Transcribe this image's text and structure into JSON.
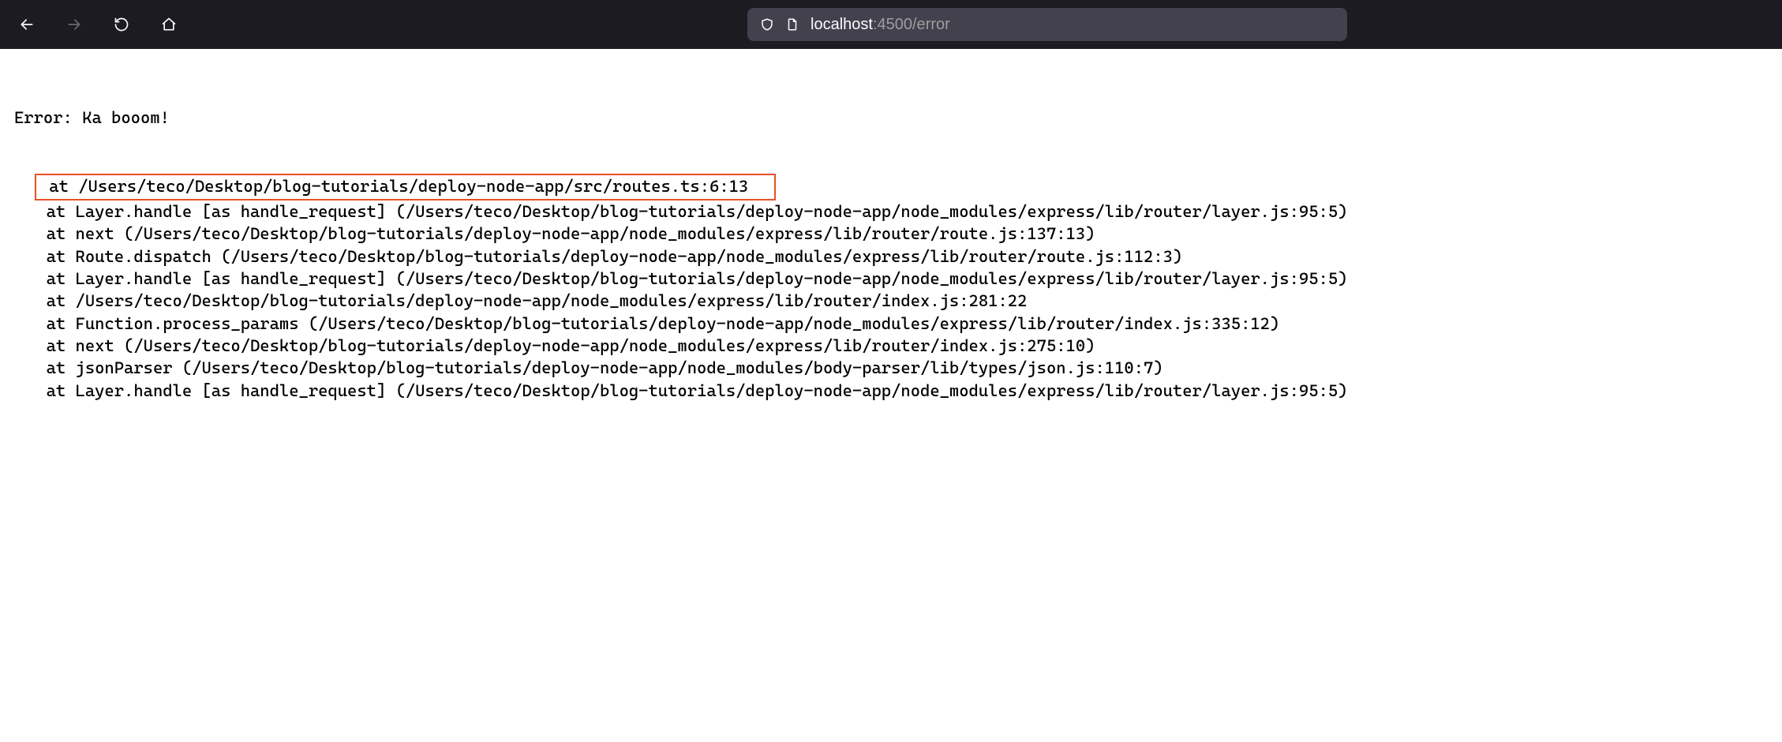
{
  "browser": {
    "url_host": "localhost",
    "url_rest": ":4500/error"
  },
  "error": {
    "header": "Error: Ka booom!",
    "stack": [
      "at /Users/teco/Desktop/blog-tutorials/deploy-node-app/src/routes.ts:6:13",
      "at Layer.handle [as handle_request] (/Users/teco/Desktop/blog-tutorials/deploy-node-app/node_modules/express/lib/router/layer.js:95:5)",
      "at next (/Users/teco/Desktop/blog-tutorials/deploy-node-app/node_modules/express/lib/router/route.js:137:13)",
      "at Route.dispatch (/Users/teco/Desktop/blog-tutorials/deploy-node-app/node_modules/express/lib/router/route.js:112:3)",
      "at Layer.handle [as handle_request] (/Users/teco/Desktop/blog-tutorials/deploy-node-app/node_modules/express/lib/router/layer.js:95:5)",
      "at /Users/teco/Desktop/blog-tutorials/deploy-node-app/node_modules/express/lib/router/index.js:281:22",
      "at Function.process_params (/Users/teco/Desktop/blog-tutorials/deploy-node-app/node_modules/express/lib/router/index.js:335:12)",
      "at next (/Users/teco/Desktop/blog-tutorials/deploy-node-app/node_modules/express/lib/router/index.js:275:10)",
      "at jsonParser (/Users/teco/Desktop/blog-tutorials/deploy-node-app/node_modules/body-parser/lib/types/json.js:110:7)",
      "at Layer.handle [as handle_request] (/Users/teco/Desktop/blog-tutorials/deploy-node-app/node_modules/express/lib/router/layer.js:95:5)"
    ],
    "highlighted_index": 0
  }
}
